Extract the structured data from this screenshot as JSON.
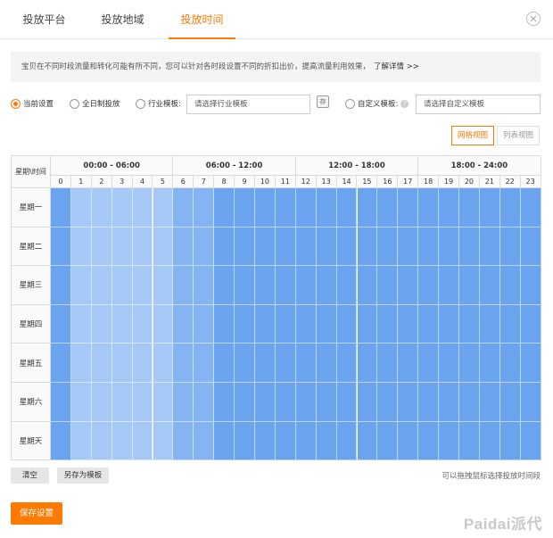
{
  "tabs": [
    {
      "label": "投放平台",
      "active": false
    },
    {
      "label": "投放地域",
      "active": false
    },
    {
      "label": "投放时间",
      "active": true
    }
  ],
  "info": {
    "text": "宝贝在不同时段流量和转化可能有所不同，您可以针对各时段设置不同的折扣出价，提高流量利用效果，",
    "link": "了解详情 >>"
  },
  "options": {
    "current": "当前设置",
    "allday": "全日制投放",
    "industry": "行业模板:",
    "industry_placeholder": "请选择行业模板",
    "save_icon": "存",
    "custom": "自定义模板:",
    "custom_placeholder": "请选择自定义模板"
  },
  "views": {
    "grid": "网格视图",
    "list": "列表视图",
    "active": "grid"
  },
  "grid": {
    "corner": "星期\\时间",
    "groups": [
      "00:00 - 06:00",
      "06:00 - 12:00",
      "12:00 - 18:00",
      "18:00 - 24:00"
    ],
    "hours": [
      "0",
      "1",
      "2",
      "3",
      "4",
      "5",
      "6",
      "7",
      "8",
      "9",
      "10",
      "11",
      "12",
      "13",
      "14",
      "15",
      "16",
      "17",
      "18",
      "19",
      "20",
      "21",
      "22",
      "23"
    ],
    "days": [
      "星期一",
      "星期二",
      "星期三",
      "星期四",
      "星期五",
      "星期六",
      "星期天"
    ],
    "hour_colors": [
      "#6aa3ee",
      "#a6c8f6",
      "#a6c8f6",
      "#a6c8f6",
      "#a6c8f6",
      "#a6c8f6",
      "#84b4f2",
      "#84b4f2",
      "#6aa3ee",
      "#6aa3ee",
      "#6aa3ee",
      "#6aa3ee",
      "#6aa3ee",
      "#6aa3ee",
      "#6aa3ee",
      "#6aa3ee",
      "#6aa3ee",
      "#6aa3ee",
      "#6aa3ee",
      "#6aa3ee",
      "#6aa3ee",
      "#6aa3ee",
      "#6aa3ee",
      "#6aa3ee"
    ]
  },
  "buttons": {
    "clear": "清空",
    "save_template": "另存为模板",
    "save": "保存设置"
  },
  "hint": "可以拖拽鼠标选择投放时间段",
  "watermark": "Paidai派代"
}
